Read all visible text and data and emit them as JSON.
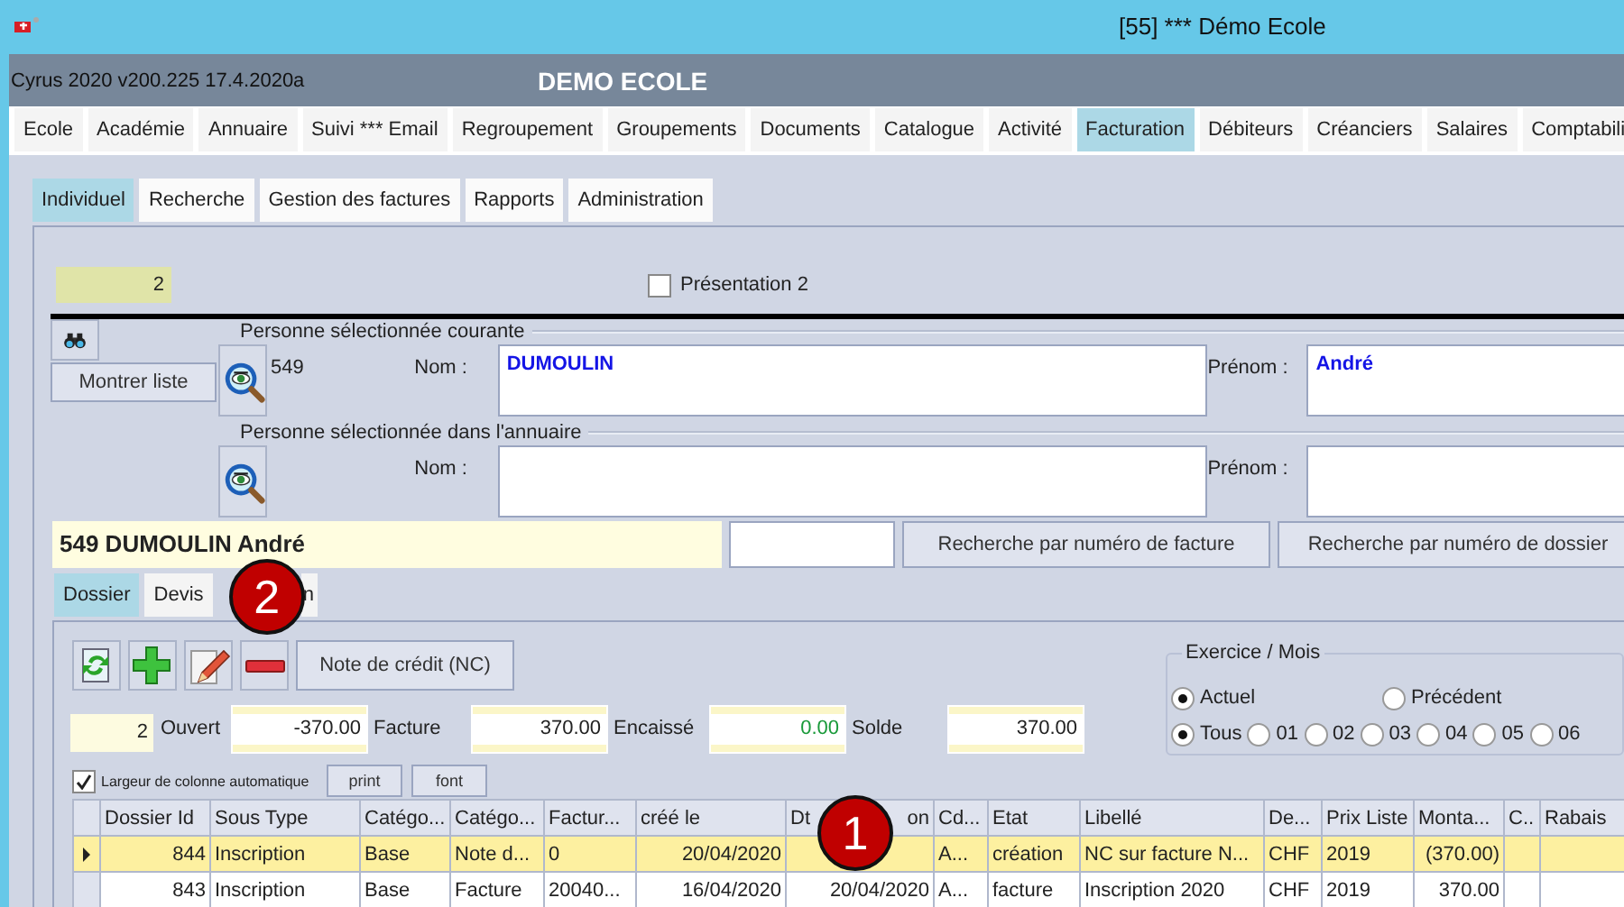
{
  "window": {
    "title": "[55] *** Démo Ecole"
  },
  "header": {
    "version": "Cyrus 2020 v200.225 17.4.2020a",
    "school": "DEMO ECOLE"
  },
  "main_menu": [
    {
      "label": "Ecole",
      "selected": false
    },
    {
      "label": "Académie",
      "selected": false
    },
    {
      "label": "Annuaire",
      "selected": false
    },
    {
      "label": "Suivi *** Email",
      "selected": false
    },
    {
      "label": "Regroupement",
      "selected": false
    },
    {
      "label": "Groupements",
      "selected": false
    },
    {
      "label": "Documents",
      "selected": false
    },
    {
      "label": "Catalogue",
      "selected": false
    },
    {
      "label": "Activité",
      "selected": false
    },
    {
      "label": "Facturation",
      "selected": true
    },
    {
      "label": "Débiteurs",
      "selected": false
    },
    {
      "label": "Créanciers",
      "selected": false
    },
    {
      "label": "Salaires",
      "selected": false
    },
    {
      "label": "Comptabili",
      "selected": false
    }
  ],
  "sub_tabs": [
    {
      "label": "Individuel",
      "selected": true
    },
    {
      "label": "Recherche",
      "selected": false
    },
    {
      "label": "Gestion des factures",
      "selected": false
    },
    {
      "label": "Rapports",
      "selected": false
    },
    {
      "label": "Administration",
      "selected": false
    }
  ],
  "counter": "2",
  "presentation": {
    "label": "Présentation 2",
    "checked": false
  },
  "show_list_button": "Montrer liste",
  "current_person": {
    "title": "Personne sélectionnée courante",
    "id": "549",
    "name_label": "Nom :",
    "name": "DUMOULIN",
    "first_name_label": "Prénom :",
    "first_name": "André"
  },
  "directory_person": {
    "title": "Personne sélectionnée dans l'annuaire",
    "name_label": "Nom :",
    "first_name_label": "Prénom :"
  },
  "selected_person": "549 DUMOULIN André",
  "search_buttons": [
    "Recherche par numéro de facture",
    "Recherche par numéro de dossier"
  ],
  "record_tabs": [
    {
      "label": "Dossier",
      "selected": true
    },
    {
      "label": "Devis",
      "selected": false
    },
    {
      "label": "n",
      "selected": false,
      "callout": "2"
    }
  ],
  "credit_note_button": "Note de crédit (NC)",
  "summary": {
    "count": "2",
    "fields": [
      {
        "label": "Ouvert",
        "value": "-370.00",
        "kind": "plain"
      },
      {
        "label": "Facture",
        "value": "370.00",
        "kind": "plain"
      },
      {
        "label": "Encaissé",
        "value": "0.00",
        "kind": "paid"
      },
      {
        "label": "Solde",
        "value": "370.00",
        "kind": "plain"
      }
    ]
  },
  "period": {
    "title": "Exercice / Mois",
    "years": [
      {
        "label": "Actuel",
        "selected": true
      },
      {
        "label": "Précédent",
        "selected": false
      }
    ],
    "months": [
      {
        "label": "Tous",
        "selected": true
      },
      {
        "label": "01",
        "selected": false
      },
      {
        "label": "02",
        "selected": false
      },
      {
        "label": "03",
        "selected": false
      },
      {
        "label": "04",
        "selected": false
      },
      {
        "label": "05",
        "selected": false
      },
      {
        "label": "06",
        "selected": false
      }
    ]
  },
  "auto_width": {
    "label": "Largeur de colonne automatique",
    "checked": true
  },
  "grid_buttons": [
    "print",
    "font"
  ],
  "table": {
    "columns": [
      {
        "label": "Dossier Id"
      },
      {
        "label": "Sous Type"
      },
      {
        "label": "Catégo..."
      },
      {
        "label": "Catégo..."
      },
      {
        "label": "Factur..."
      },
      {
        "label": "créé le"
      },
      {
        "label": "Dt",
        "tail": "on",
        "callout": "1"
      },
      {
        "label": "Cd..."
      },
      {
        "label": "Etat"
      },
      {
        "label": "Libellé"
      },
      {
        "label": "De..."
      },
      {
        "label": "Prix Liste"
      },
      {
        "label": "Monta..."
      },
      {
        "label": "C.."
      },
      {
        "label": "Rabais"
      }
    ],
    "rows": [
      {
        "selected": true,
        "cells": [
          "844",
          "Inscription",
          "Base",
          "Note d...",
          "0",
          "20/04/2020",
          null,
          "A...",
          "création",
          "NC sur facture N...",
          "CHF",
          "2019",
          "(370.00)",
          null,
          null
        ]
      },
      {
        "selected": false,
        "cells": [
          "843",
          "Inscription",
          "Base",
          "Facture",
          "20040...",
          "16/04/2020",
          "20/04/2020",
          "A...",
          "facture",
          "Inscription 2020",
          "CHF",
          "2019",
          "370.00",
          null,
          null
        ]
      }
    ]
  }
}
